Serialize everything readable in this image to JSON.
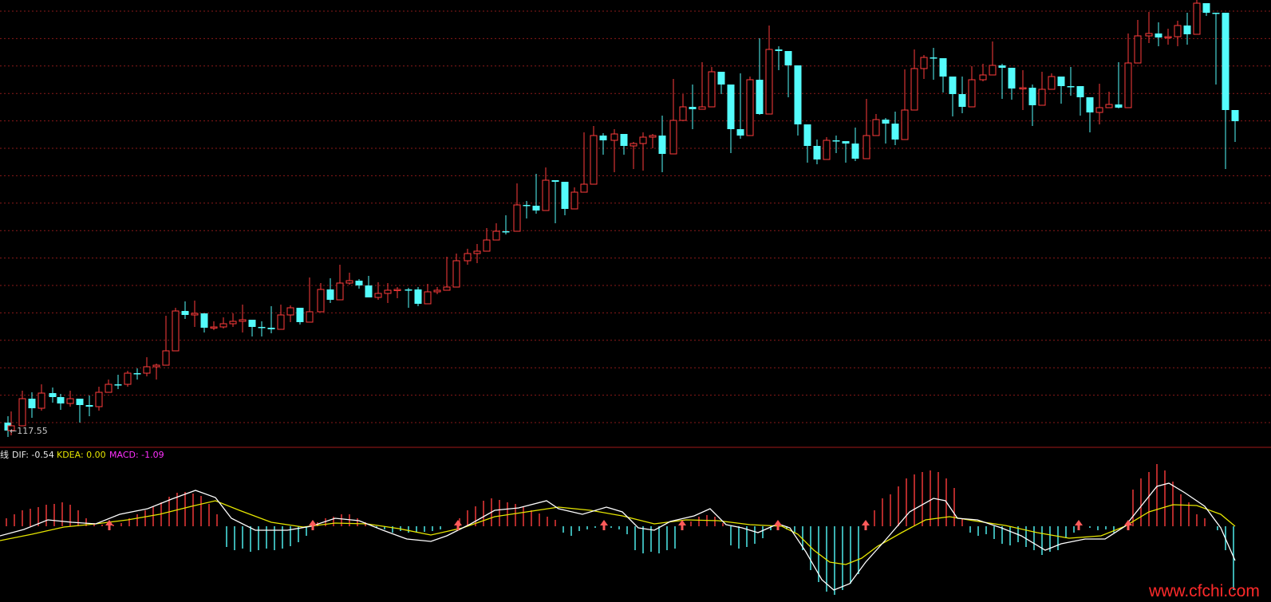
{
  "price_panel": {
    "low_marker_text": "←117.55"
  },
  "indicator_panel": {
    "name_fragment": "线",
    "dif_text": "DIF: -0.54",
    "kdea_text": "KDEA: 0.00",
    "macd_text": "MACD: -1.09"
  },
  "watermark": "www.cfchi.com",
  "colors": {
    "background": "#000000",
    "up_candle": "#ff3c3c",
    "down_candle": "#54fcfc",
    "grid": "#8a1a1a",
    "separator": "#a01818",
    "dif_line": "#ffffff",
    "dea_line": "#e6e600",
    "macd_label": "#ff30ff",
    "signal_arrow": "#ff5a5a"
  },
  "chart_data": [
    {
      "type": "candlestick",
      "title": "",
      "y_min_marker": 117.55,
      "candles": [
        [
          10,
          540,
          548,
          522
        ],
        [
          14,
          534,
          546,
          516
        ],
        [
          28,
          500,
          530,
          490
        ],
        [
          40,
          512,
          524,
          492
        ],
        [
          52,
          493,
          515,
          482
        ],
        [
          66,
          498,
          505,
          486
        ],
        [
          76,
          506,
          514,
          494
        ],
        [
          88,
          500,
          510,
          490
        ],
        [
          100,
          508,
          530,
          506
        ],
        [
          112,
          510,
          522,
          496
        ],
        [
          124,
          492,
          515,
          485
        ],
        [
          136,
          482,
          492,
          476
        ],
        [
          148,
          482,
          488,
          470
        ],
        [
          160,
          468,
          485,
          465
        ],
        [
          172,
          468,
          476,
          462
        ],
        [
          184,
          460,
          472,
          448
        ],
        [
          196,
          458,
          476,
          456
        ],
        [
          208,
          440,
          442,
          396
        ],
        [
          220,
          390,
          404,
          386
        ],
        [
          232,
          395,
          400,
          378
        ],
        [
          244,
          393,
          410,
          377
        ],
        [
          256,
          411,
          417,
          398
        ],
        [
          268,
          410,
          414,
          403
        ],
        [
          280,
          406,
          412,
          398
        ],
        [
          292,
          403,
          410,
          393
        ],
        [
          304,
          401,
          417,
          382
        ],
        [
          316,
          410,
          422,
          406
        ],
        [
          328,
          411,
          422,
          403
        ],
        [
          340,
          413,
          418,
          384
        ],
        [
          352,
          395,
          402,
          382
        ],
        [
          364,
          386,
          404,
          383
        ],
        [
          376,
          404,
          407,
          388
        ],
        [
          388,
          391,
          395,
          348
        ],
        [
          402,
          363,
          384,
          355
        ],
        [
          414,
          376,
          380,
          349
        ],
        [
          426,
          355,
          360,
          332
        ],
        [
          438,
          352,
          357,
          342
        ],
        [
          450,
          358,
          362,
          350
        ],
        [
          462,
          373,
          373,
          346
        ],
        [
          474,
          368,
          376,
          354
        ],
        [
          486,
          364,
          380,
          355
        ],
        [
          498,
          363,
          374,
          360
        ],
        [
          512,
          363,
          386,
          361
        ],
        [
          524,
          381,
          384,
          360
        ],
        [
          536,
          366,
          373,
          356
        ],
        [
          548,
          364,
          369,
          360
        ],
        [
          560,
          360,
          364,
          322
        ],
        [
          572,
          327,
          342,
          318
        ],
        [
          586,
          318,
          332,
          312
        ],
        [
          598,
          315,
          330,
          306
        ],
        [
          610,
          301,
          309,
          286
        ],
        [
          622,
          290,
          301,
          280
        ],
        [
          634,
          290,
          294,
          270
        ],
        [
          648,
          257,
          262,
          230
        ],
        [
          660,
          258,
          274,
          252
        ],
        [
          672,
          264,
          268,
          218
        ],
        [
          684,
          226,
          234,
          210
        ],
        [
          696,
          228,
          280,
          228
        ],
        [
          708,
          262,
          270,
          243
        ],
        [
          720,
          241,
          256,
          235
        ],
        [
          732,
          231,
          238,
          166
        ],
        [
          744,
          170,
          183,
          158
        ],
        [
          756,
          176,
          194,
          167
        ],
        [
          770,
          168,
          216,
          162
        ],
        [
          782,
          183,
          194,
          178
        ],
        [
          794,
          180,
          212,
          178
        ],
        [
          806,
          172,
          214,
          166
        ],
        [
          818,
          170,
          186,
          168
        ],
        [
          830,
          193,
          216,
          145
        ],
        [
          844,
          151,
          160,
          99
        ],
        [
          856,
          134,
          142,
          118
        ],
        [
          868,
          137,
          162,
          106
        ],
        [
          880,
          134,
          136,
          78
        ],
        [
          892,
          90,
          114,
          84
        ],
        [
          904,
          106,
          118,
          98
        ],
        [
          916,
          162,
          192,
          158
        ],
        [
          928,
          170,
          174,
          92
        ],
        [
          940,
          100,
          122,
          96
        ],
        [
          952,
          143,
          144,
          48
        ],
        [
          964,
          62,
          72,
          32
        ],
        [
          976,
          64,
          88,
          58
        ],
        [
          988,
          82,
          122,
          80
        ],
        [
          1000,
          156,
          170,
          152
        ],
        [
          1012,
          183,
          204,
          180
        ],
        [
          1024,
          200,
          206,
          175
        ],
        [
          1036,
          176,
          195,
          172
        ],
        [
          1048,
          177,
          192,
          170
        ],
        [
          1060,
          180,
          204,
          180
        ],
        [
          1072,
          199,
          202,
          160
        ],
        [
          1086,
          170,
          172,
          124
        ],
        [
          1098,
          150,
          158,
          143
        ],
        [
          1110,
          155,
          180,
          148
        ],
        [
          1122,
          175,
          182,
          140
        ],
        [
          1134,
          138,
          148,
          87
        ],
        [
          1146,
          86,
          96,
          62
        ],
        [
          1158,
          72,
          99,
          69
        ],
        [
          1170,
          73,
          100,
          60
        ],
        [
          1182,
          96,
          116,
          90
        ],
        [
          1194,
          118,
          146,
          116
        ],
        [
          1206,
          134,
          142,
          96
        ],
        [
          1218,
          100,
          116,
          83
        ],
        [
          1232,
          94,
          102,
          80
        ],
        [
          1244,
          82,
          90,
          52
        ],
        [
          1256,
          85,
          124,
          80
        ],
        [
          1268,
          111,
          125,
          95
        ],
        [
          1282,
          110,
          138,
          88
        ],
        [
          1294,
          132,
          158,
          106
        ],
        [
          1306,
          112,
          120,
          90
        ],
        [
          1318,
          96,
          108,
          92
        ],
        [
          1330,
          108,
          130,
          97
        ],
        [
          1342,
          108,
          120,
          84
        ],
        [
          1354,
          122,
          145,
          118
        ],
        [
          1366,
          141,
          166,
          130
        ],
        [
          1378,
          135,
          156,
          105
        ],
        [
          1390,
          131,
          131,
          115
        ],
        [
          1402,
          135,
          136,
          78
        ],
        [
          1414,
          79,
          90,
          42
        ],
        [
          1426,
          45,
          61,
          25
        ],
        [
          1440,
          42,
          54,
          15
        ],
        [
          1452,
          47,
          58,
          28
        ],
        [
          1464,
          46,
          56,
          36
        ],
        [
          1476,
          32,
          58,
          26
        ],
        [
          1488,
          43,
          56,
          16
        ],
        [
          1500,
          4,
          24,
          0
        ],
        [
          1512,
          16,
          20,
          10
        ],
        [
          1524,
          16,
          106,
          16
        ],
        [
          1536,
          138,
          212,
          92
        ],
        [
          1548,
          152,
          178,
          145
        ]
      ]
    },
    {
      "type": "line",
      "title": "",
      "series": [
        {
          "name": "DIF",
          "points": [
            [
              0,
              672
            ],
            [
              30,
              664
            ],
            [
              60,
              652
            ],
            [
              90,
              655
            ],
            [
              120,
              657
            ],
            [
              150,
              645
            ],
            [
              185,
              638
            ],
            [
              215,
              626
            ],
            [
              245,
              615
            ],
            [
              270,
              624
            ],
            [
              290,
              650
            ],
            [
              320,
              665
            ],
            [
              360,
              665
            ],
            [
              390,
              660
            ],
            [
              420,
              650
            ],
            [
              450,
              653
            ],
            [
              480,
              665
            ],
            [
              510,
              676
            ],
            [
              540,
              679
            ],
            [
              560,
              672
            ],
            [
              590,
              657
            ],
            [
              620,
              640
            ],
            [
              650,
              637
            ],
            [
              685,
              628
            ],
            [
              700,
              638
            ],
            [
              730,
              645
            ],
            [
              760,
              636
            ],
            [
              780,
              642
            ],
            [
              800,
              662
            ],
            [
              820,
              665
            ],
            [
              840,
              654
            ],
            [
              870,
              647
            ],
            [
              890,
              638
            ],
            [
              910,
              658
            ],
            [
              930,
              662
            ],
            [
              950,
              668
            ],
            [
              975,
              657
            ],
            [
              990,
              662
            ],
            [
              1010,
              692
            ],
            [
              1030,
              727
            ],
            [
              1045,
              740
            ],
            [
              1065,
              732
            ],
            [
              1085,
              705
            ],
            [
              1110,
              677
            ],
            [
              1140,
              642
            ],
            [
              1170,
              625
            ],
            [
              1185,
              628
            ],
            [
              1200,
              650
            ],
            [
              1225,
              652
            ],
            [
              1255,
              662
            ],
            [
              1280,
              672
            ],
            [
              1310,
              690
            ],
            [
              1330,
              682
            ],
            [
              1360,
              676
            ],
            [
              1385,
              676
            ],
            [
              1410,
              660
            ],
            [
              1430,
              635
            ],
            [
              1450,
              610
            ],
            [
              1465,
              606
            ],
            [
              1485,
              618
            ],
            [
              1510,
              635
            ],
            [
              1530,
              662
            ],
            [
              1548,
              703
            ]
          ]
        },
        {
          "name": "DEA",
          "points": [
            [
              0,
              678
            ],
            [
              40,
              670
            ],
            [
              80,
              661
            ],
            [
              120,
              657
            ],
            [
              160,
              652
            ],
            [
              200,
              645
            ],
            [
              240,
              635
            ],
            [
              270,
              628
            ],
            [
              300,
              640
            ],
            [
              340,
              655
            ],
            [
              380,
              661
            ],
            [
              420,
              656
            ],
            [
              460,
              657
            ],
            [
              500,
              663
            ],
            [
              540,
              671
            ],
            [
              580,
              662
            ],
            [
              620,
              648
            ],
            [
              660,
              642
            ],
            [
              700,
              636
            ],
            [
              740,
              640
            ],
            [
              780,
              647
            ],
            [
              820,
              657
            ],
            [
              860,
              652
            ],
            [
              900,
              653
            ],
            [
              940,
              658
            ],
            [
              980,
              660
            ],
            [
              1000,
              670
            ],
            [
              1020,
              690
            ],
            [
              1040,
              705
            ],
            [
              1060,
              708
            ],
            [
              1080,
              700
            ],
            [
              1100,
              685
            ],
            [
              1130,
              668
            ],
            [
              1160,
              652
            ],
            [
              1190,
              648
            ],
            [
              1220,
              653
            ],
            [
              1260,
              659
            ],
            [
              1300,
              668
            ],
            [
              1340,
              675
            ],
            [
              1380,
              672
            ],
            [
              1410,
              660
            ],
            [
              1440,
              642
            ],
            [
              1470,
              633
            ],
            [
              1500,
              634
            ],
            [
              1530,
              645
            ],
            [
              1548,
              660
            ]
          ]
        }
      ]
    }
  ]
}
